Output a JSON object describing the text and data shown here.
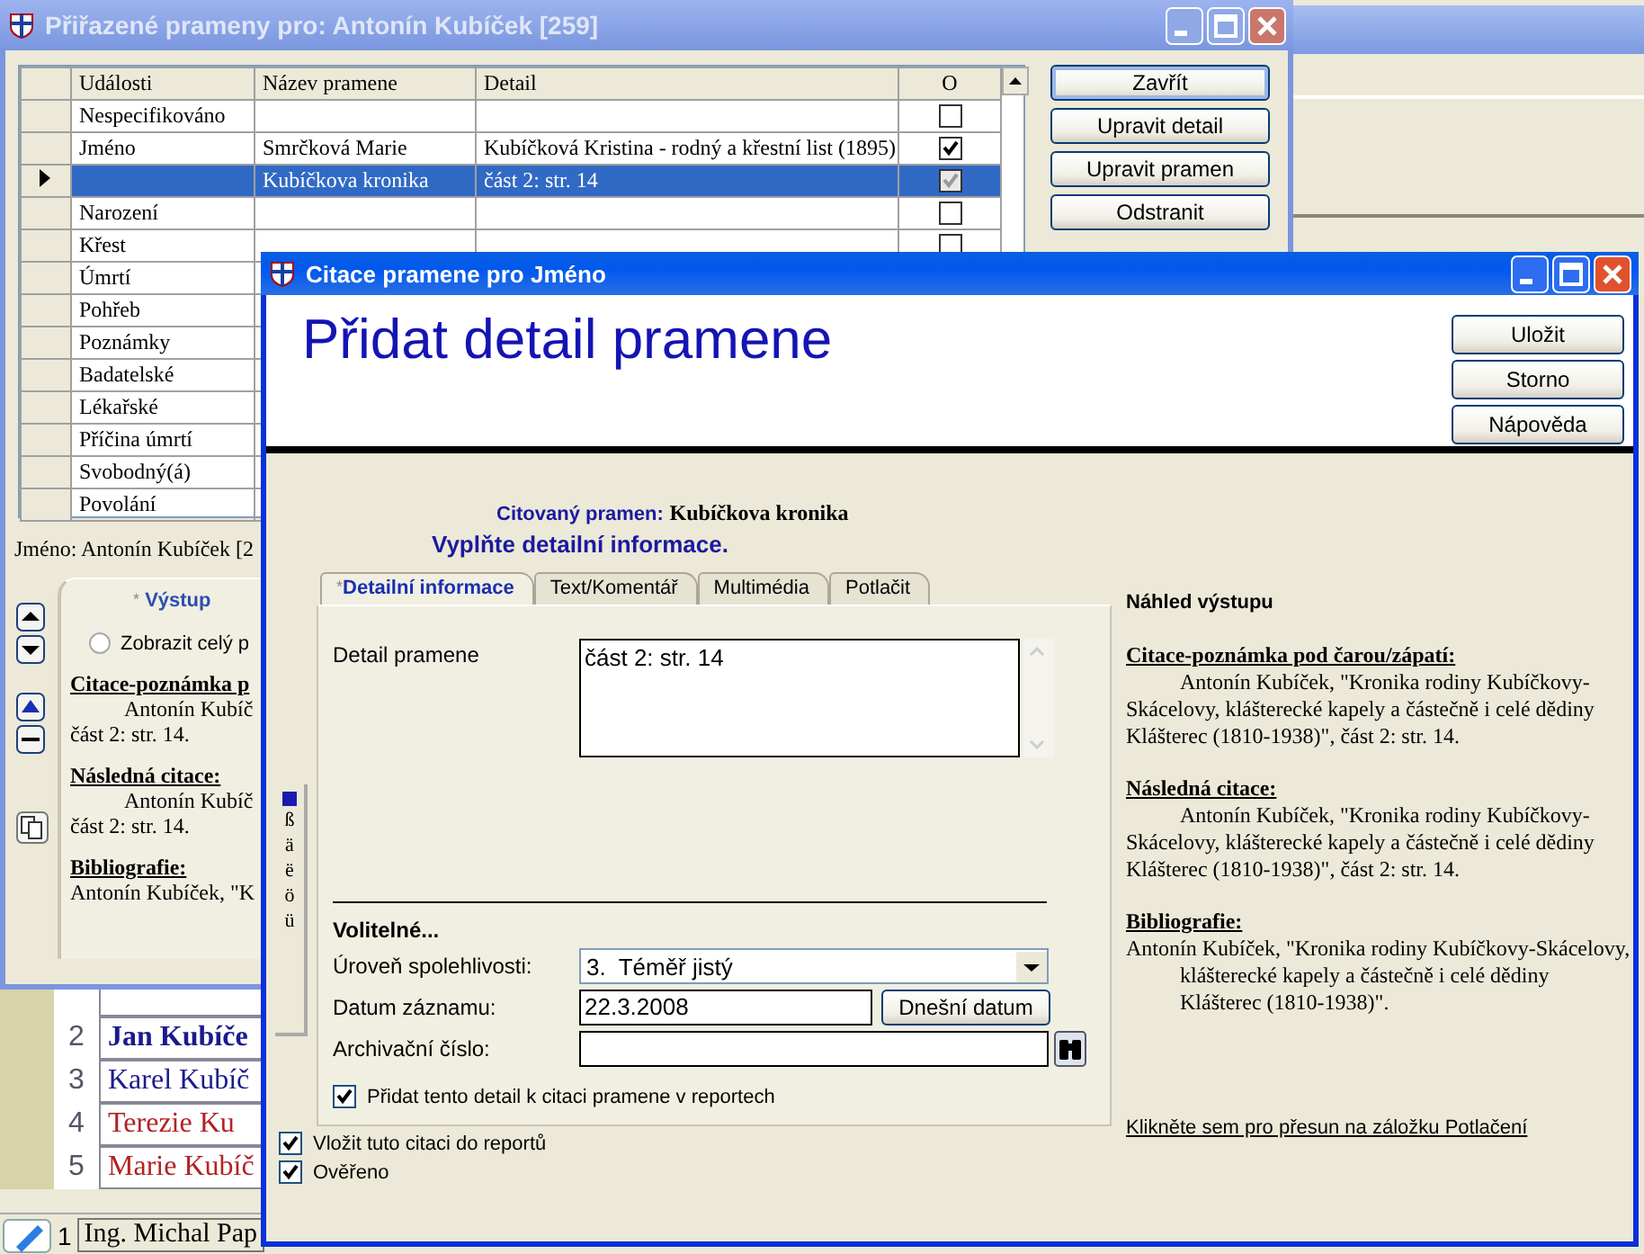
{
  "background_app": {
    "people": [
      {
        "number": "2",
        "name": "Jan Kubíče",
        "color": "#1a1a8c",
        "bold": true
      },
      {
        "number": "3",
        "name": "Karel Kubíč",
        "color": "#1a1a8c",
        "bold": false
      },
      {
        "number": "4",
        "name": "Terezie Ku",
        "color": "#b22222",
        "bold": false
      },
      {
        "number": "5",
        "name": "Marie Kubíč",
        "color": "#b22222",
        "bold": false
      }
    ],
    "taskbar": {
      "number": "1",
      "name": "Ing. Michal Pap"
    }
  },
  "assigned_window": {
    "title": "Přiřazené prameny pro: Antonín Kubíček [259]",
    "table": {
      "columns": [
        "Události",
        "Název pramene",
        "Detail",
        "O"
      ],
      "rows": [
        {
          "event": "Nespecifikováno",
          "checked": false,
          "selected": false
        },
        {
          "event": "Jméno",
          "source": "Smrčková Marie",
          "detail": "Kubíčková Kristina - rodný a křestní list (1895)",
          "checked": true,
          "selected": false
        },
        {
          "source": "Kubíčkova kronika",
          "detail": "část 2: str. 14",
          "checked": true,
          "selected": true
        },
        {
          "event": "Narození",
          "checked": false,
          "selected": false
        },
        {
          "event": "Křest",
          "checked": false,
          "selected": false
        },
        {
          "event": "Úmrtí",
          "selected": false
        },
        {
          "event": "Pohřeb",
          "selected": false
        },
        {
          "event": "Poznámky",
          "selected": false
        },
        {
          "event": "Badatelské",
          "selected": false
        },
        {
          "event": "Lékařské",
          "selected": false
        },
        {
          "event": "Příčina úmrtí",
          "selected": false
        },
        {
          "event": "Svobodný(á)",
          "selected": false
        },
        {
          "event": "Povolání",
          "selected": false
        }
      ]
    },
    "buttons": [
      {
        "label": "Zavřít",
        "default": true
      },
      {
        "label": "Upravit detail",
        "default": false
      },
      {
        "label": "Upravit pramen",
        "default": false
      },
      {
        "label": "Odstranit",
        "default": false
      }
    ],
    "person_label": "Jméno: Antonín Kubíček [2",
    "output_panel": {
      "tab_marker": "*",
      "tab": "Výstup",
      "radio": {
        "label": "Zobrazit celý p",
        "selected": false
      },
      "sections": [
        {
          "kind": "indent",
          "heading": "Citace-poznámka p",
          "lines": [
            "Antonín Kubíč",
            "část 2: str. 14."
          ]
        },
        {
          "kind": "indent",
          "heading": "Následná citace:",
          "lines": [
            "Antonín Kubíč",
            "část 2: str. 14."
          ]
        },
        {
          "kind": "hanging",
          "heading": "Bibliografie:",
          "lines": [
            "Antonín Kubíček, \"K"
          ]
        }
      ]
    }
  },
  "citation_window": {
    "title": "Citace pramene pro Jméno",
    "heading": "Přidat detail pramene",
    "buttons": [
      "Uložit",
      "Storno",
      "Nápověda"
    ],
    "cited_label": "Citovaný pramen:",
    "cited_value": "Kubíčkova kronika",
    "instruction": "Vyplňte detailní informace.",
    "tabs": [
      {
        "marker": "*",
        "label": "Detailní informace",
        "selected": true
      },
      {
        "label": "Text/Komentář",
        "selected": false
      },
      {
        "label": "Multimédia",
        "selected": false
      },
      {
        "label": "Potlačit",
        "selected": false
      }
    ],
    "detail": {
      "label": "Detail pramene",
      "value": "část 2: str. 14"
    },
    "special_chars": [
      "ß",
      "ä",
      "ë",
      "ö",
      "ü"
    ],
    "optional": {
      "title": "Volitelné...",
      "reliability": {
        "label": "Úroveň spolehlivosti:",
        "value": "3.  Téměř jistý"
      },
      "date": {
        "label": "Datum záznamu:",
        "value": "22.3.2008",
        "button": "Dnešní datum"
      },
      "archive": {
        "label": "Archivační číslo:"
      },
      "include_detail": {
        "label": "Přidat tento detail k citaci pramene v reportech",
        "checked": true
      }
    },
    "options": [
      {
        "label": "Vložit tuto citaci do reportů",
        "checked": true
      },
      {
        "label": "Ověřeno",
        "checked": true
      }
    ],
    "preview": {
      "title": "Náhled výstupu",
      "sections": [
        {
          "kind": "indent",
          "heading": "Citace-poznámka pod čarou/zápatí:",
          "text": "Antonín Kubíček, \"Kronika rodiny Kubíčkovy-Skácelovy, klášterecké kapely a částečně i celé dědiny Klášterec (1810-1938)\", část 2: str. 14."
        },
        {
          "kind": "indent",
          "heading": "Následná citace:",
          "text": "Antonín Kubíček, \"Kronika rodiny Kubíčkovy-Skácelovy, klášterecké kapely a částečně i celé dědiny Klášterec (1810-1938)\", část 2: str. 14."
        },
        {
          "kind": "hanging",
          "heading": "Bibliografie:",
          "text": "Antonín Kubíček, \"Kronika rodiny Kubíčkovy-Skácelovy, klášterecké kapely a částečně i celé dědiny Klášterec (1810-1938)\"."
        }
      ],
      "link": "Klikněte sem pro přesun na záložku Potlačení"
    }
  }
}
